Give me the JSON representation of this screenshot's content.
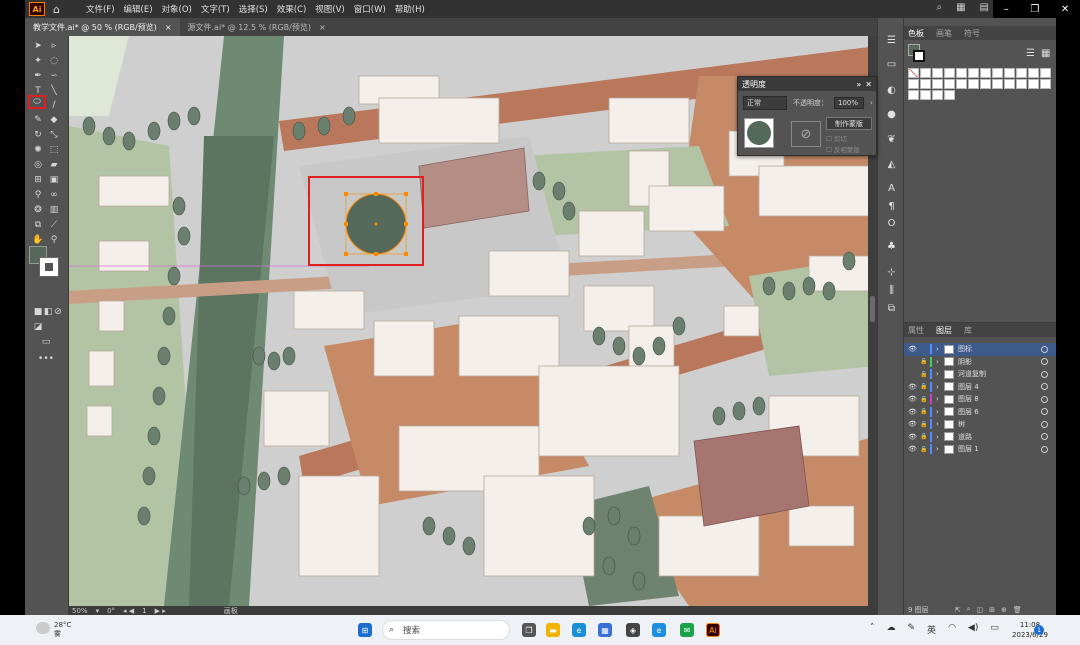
{
  "menubar": {
    "logo": "Ai",
    "items": [
      "文件(F)",
      "编辑(E)",
      "对象(O)",
      "文字(T)",
      "选择(S)",
      "效果(C)",
      "视图(V)",
      "窗口(W)",
      "帮助(H)"
    ]
  },
  "tabs": [
    {
      "label": "教学文件.ai* @ 50 % (RGB/预览)",
      "close": "×",
      "active": true
    },
    {
      "label": "源文件.ai* @ 12.5 % (RGB/预览)",
      "close": "×",
      "active": false
    }
  ],
  "colors": {
    "fill": "#55695a",
    "highlight": "#e02020",
    "road": "#b9785c",
    "plaza": "#cfcfcf",
    "green": "#b3c4a5",
    "building": "#f4efea",
    "tree": "#6b7f6f"
  },
  "swatch_panel": {
    "tabs": [
      "色板",
      "画笔",
      "符号"
    ]
  },
  "transparency": {
    "title": "透明度",
    "blend_mode": "正常",
    "opacity_label": "不透明度：",
    "opacity_value": "100%",
    "mask_button": "制作蒙版",
    "clip_label": "剪切",
    "invert_label": "反相蒙版"
  },
  "layers_panel": {
    "tabs": [
      "属性",
      "图层",
      "库"
    ],
    "layers": [
      {
        "name": "图标",
        "color": "#4f8cff"
      },
      {
        "name": "阴影",
        "color": "#3fd060"
      },
      {
        "name": "河道复制",
        "color": "#4f8cff"
      },
      {
        "name": "图层 4",
        "color": "#4f8cff"
      },
      {
        "name": "图层 8",
        "color": "#d040d0"
      },
      {
        "name": "图层 6",
        "color": "#4f8cff"
      },
      {
        "name": "树",
        "color": "#4f8cff"
      },
      {
        "name": "道路",
        "color": "#4f8cff"
      },
      {
        "name": "图层 1",
        "color": "#4f8cff"
      }
    ],
    "count": "9 图层"
  },
  "statusbar": {
    "zoom": "50%",
    "rotation": "0°",
    "artboard": "1",
    "tool": "画板"
  },
  "taskbar": {
    "weather_temp": "28°C",
    "weather_desc": "雾",
    "search": "搜索",
    "lang": "英",
    "time": "11:08",
    "date": "2023/6/29"
  }
}
